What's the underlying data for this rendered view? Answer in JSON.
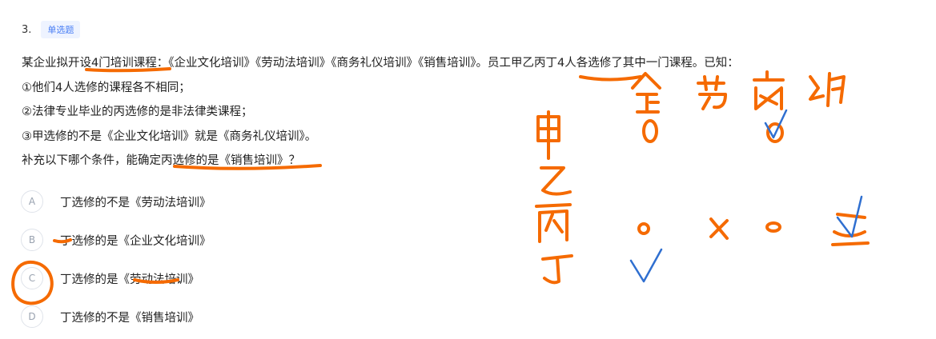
{
  "question": {
    "number": "3.",
    "type_badge": "单选题",
    "stem": {
      "intro": "某企业拟开设4门培训课程：《企业文化培训》《劳动法培训》《商务礼仪培训》《销售培训》。员工甲乙丙丁4人各选修了其中一门课程。已知：",
      "condition_1": "①他们4人选修的课程各不相同；",
      "condition_2": "②法律专业毕业的丙选修的是非法律类课程；",
      "condition_3": "③甲选修的不是《企业文化培训》就是《商务礼仪培训》。",
      "ask": "补充以下哪个条件，能确定丙选修的是《销售培训》？"
    },
    "options": [
      {
        "letter": "A",
        "text": "丁选修的不是《劳动法培训》"
      },
      {
        "letter": "B",
        "text": "丁选修的是《企业文化培训》"
      },
      {
        "letter": "C",
        "text": "丁选修的是《劳动法培训》"
      },
      {
        "letter": "D",
        "text": "丁选修的不是《销售培训》"
      }
    ]
  },
  "colors": {
    "ink_orange": "#f56a00",
    "ink_blue": "#2f6fd0",
    "badge_text": "#4a7ff5",
    "badge_bg": "#eef3ff"
  }
}
